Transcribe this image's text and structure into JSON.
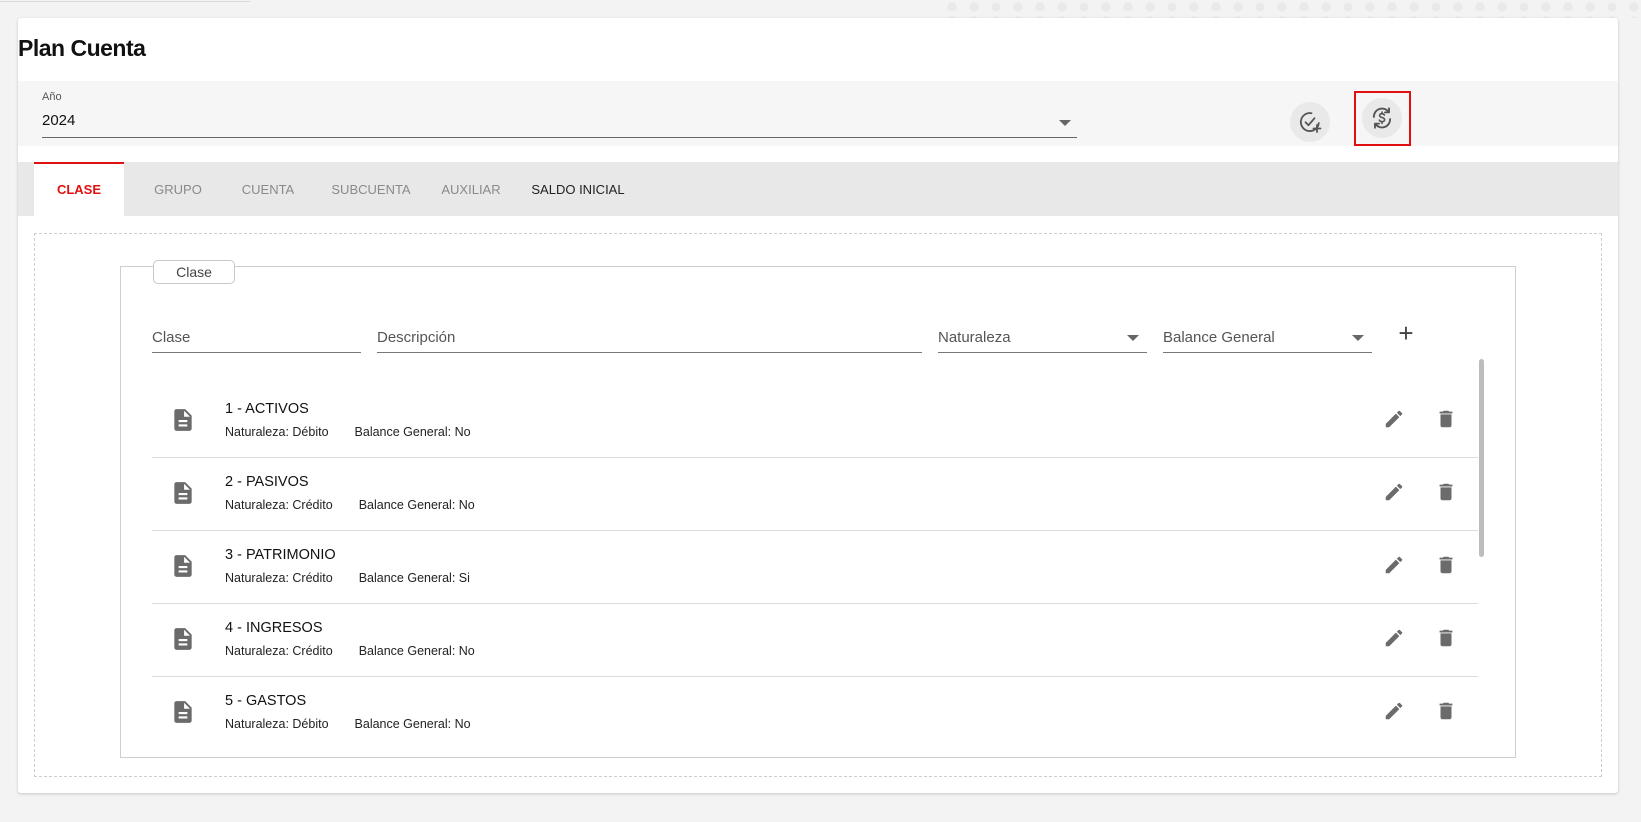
{
  "page": {
    "title": "Plan Cuenta"
  },
  "filter": {
    "year_label": "Año",
    "year_value": "2024"
  },
  "toolbar": {
    "add_year_icon": "check-circle-plus-icon",
    "currency_exchange_icon": "currency-exchange-icon"
  },
  "tabs": [
    {
      "label": "CLASE",
      "active": true
    },
    {
      "label": "GRUPO",
      "active": false
    },
    {
      "label": "CUENTA",
      "active": false
    },
    {
      "label": "SUBCUENTA",
      "active": false
    },
    {
      "label": "AUXILIAR",
      "active": false
    },
    {
      "label": "SALDO INICIAL",
      "active": false
    }
  ],
  "form": {
    "legend": "Clase",
    "clase_placeholder": "Clase",
    "descripcion_placeholder": "Descripción",
    "naturaleza_label": "Naturaleza",
    "balance_label": "Balance General",
    "add_label": "+"
  },
  "rows": [
    {
      "title": "1 - ACTIVOS",
      "naturaleza": "Naturaleza: Débito",
      "balance": "Balance General: No"
    },
    {
      "title": "2 - PASIVOS",
      "naturaleza": "Naturaleza: Crédito",
      "balance": "Balance General: No"
    },
    {
      "title": "3 - PATRIMONIO",
      "naturaleza": "Naturaleza: Crédito",
      "balance": "Balance General: Si"
    },
    {
      "title": "4 - INGRESOS",
      "naturaleza": "Naturaleza: Crédito",
      "balance": "Balance General: No"
    },
    {
      "title": "5 - GASTOS",
      "naturaleza": "Naturaleza: Débito",
      "balance": "Balance General: No"
    }
  ],
  "colors": {
    "accent": "#e01010",
    "icon": "#6b6b6b"
  }
}
